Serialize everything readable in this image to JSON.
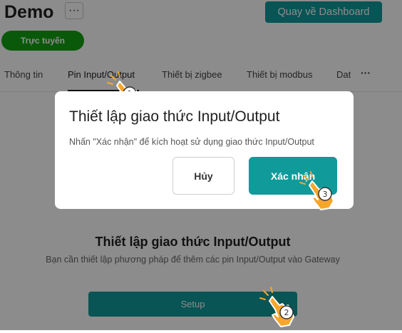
{
  "header": {
    "title": "Demo",
    "more_label": "···",
    "dashboard_button": "Quay về Dashboard",
    "status_badge": "Trực tuyến"
  },
  "tabs": [
    {
      "label": "Thông tin"
    },
    {
      "label": "Pin Input/Output"
    },
    {
      "label": "Thiết bị zigbee"
    },
    {
      "label": "Thiết bị modbus"
    },
    {
      "label": "Dat"
    }
  ],
  "tabs_more": "···",
  "main": {
    "title": "Thiết lập giao thức Input/Output",
    "subtitle": "Bạn cần thiết lập phương pháp để thêm các pin Input/Output vào Gateway",
    "setup_button": "Setup"
  },
  "modal": {
    "title": "Thiết lập giao thức Input/Output",
    "message": "Nhấn \"Xác nhận\" để kích hoạt sử dụng giao thức Input/Output",
    "cancel_button": "Hủy",
    "confirm_button": "Xác nhận"
  },
  "steps": [
    "1",
    "2",
    "3"
  ],
  "colors": {
    "accent": "#119a9a",
    "status_online": "#13a313",
    "hand_fill": "#f6a62a"
  }
}
